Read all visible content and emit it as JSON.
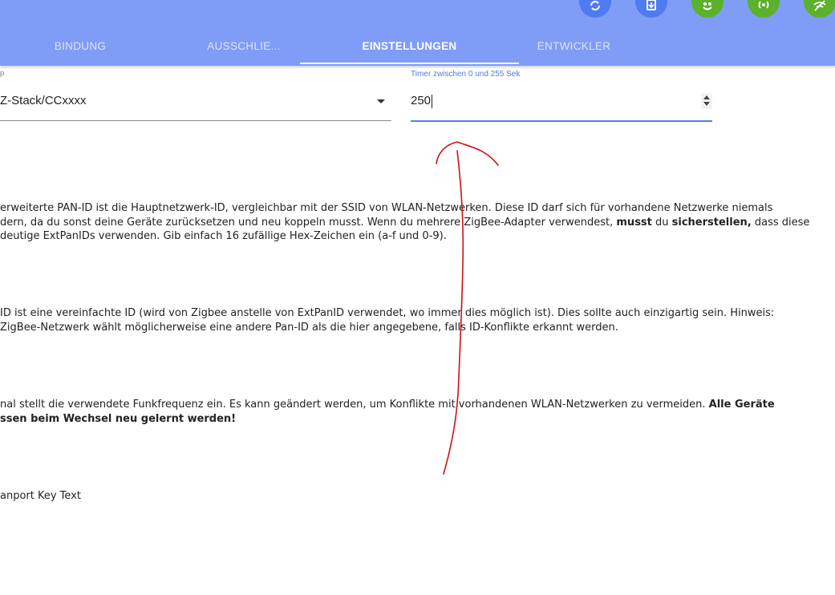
{
  "header": {
    "accent_color": "#7f9cf7",
    "buttons": [
      {
        "icon": "refresh-icon",
        "color": "#4f7bf0"
      },
      {
        "icon": "download-icon",
        "color": "#4f7bf0"
      },
      {
        "icon": "emoji-icon",
        "color": "#5bb02c"
      },
      {
        "icon": "broadcast-icon",
        "color": "#5bb02c"
      },
      {
        "icon": "wifi-off-icon",
        "color": "#5bb02c"
      }
    ]
  },
  "tabs": [
    {
      "label": "BINDUNG"
    },
    {
      "label": "AUSSCHLIE..."
    },
    {
      "label": "EINSTELLUNGEN",
      "active": true
    },
    {
      "label": "ENTWICKLER"
    }
  ],
  "form": {
    "type_label": "p",
    "type_value": "Z-Stack/CCxxxx",
    "timer_label": "Timer zwischen 0 und 255 Sek",
    "timer_value": "250"
  },
  "descriptions": {
    "extpanid": {
      "line1": "erweiterte PAN-ID ist die Hauptnetzwerk-ID, vergleichbar mit der SSID von WLAN-Netzwerken. Diese ID darf sich für vorhandene Netzwerke niemals",
      "line2_a": "dern, da du sonst deine Geräte zurücksetzen und neu koppeln musst. Wenn du mehrere ZigBee-Adapter verwendest, ",
      "line2_b": "musst",
      "line2_c": " du ",
      "line2_d": "sicherstellen,",
      "line2_e": " dass diese",
      "line3": "deutige ExtPanIDs verwenden. Gib einfach 16 zufällige Hex-Zeichen ein (a-f und 0-9)."
    },
    "panid": {
      "line1": " ID ist eine vereinfachte ID (wird von Zigbee anstelle von ExtPanID verwendet, wo immer dies möglich ist). Dies sollte auch einzigartig sein. Hinweis:",
      "line2": " ZigBee-Netzwerk wählt möglicherweise eine andere Pan-ID als die hier angegebene, falls ID-Konflikte erkannt werden."
    },
    "channel": {
      "line1_a": "nal stellt die verwendete Funkfrequenz ein. Es kann geändert werden, um Konflikte mit vorhandenen WLAN-Netzwerken zu vermeiden. ",
      "line1_b": "Alle Geräte",
      "line2": "ssen beim Wechsel neu gelernt werden!"
    },
    "transport_key": "anport Key Text"
  },
  "annotation": {
    "color": "#cc1111",
    "icon": "red-arrow-annotation"
  }
}
